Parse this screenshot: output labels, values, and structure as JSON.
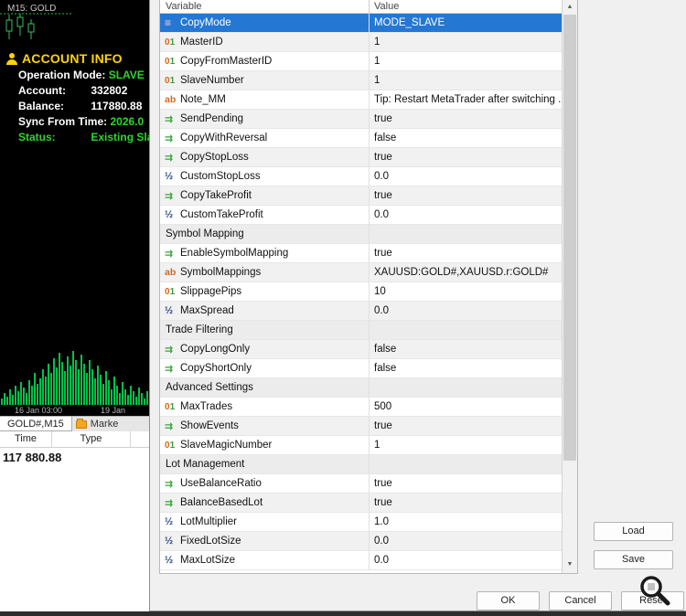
{
  "left_panel": {
    "chart_label": "M15: GOLD",
    "account_info": {
      "title": "ACCOUNT INFO",
      "rows": [
        {
          "label": "Operation Mode:",
          "value": "SLAVE"
        },
        {
          "label": "Account:",
          "value": "332802"
        },
        {
          "label": "Balance:",
          "value": "117880.88"
        },
        {
          "label": "Sync From Time:",
          "value": "2026.0"
        },
        {
          "label": "Status:",
          "value": "Existing Slave"
        }
      ]
    },
    "x_axis_labels": [
      "16 Jan 03:00",
      "19 Jan"
    ],
    "chart_tabs": [
      {
        "label": "GOLD#,M15"
      },
      {
        "label": "Marke"
      }
    ],
    "toolbox": {
      "columns": [
        "Time",
        "Type"
      ],
      "balance": "117 880.88"
    }
  },
  "dialog": {
    "table": {
      "headers": [
        "Variable",
        "Value"
      ],
      "rows": [
        {
          "type": "enum",
          "name": "CopyMode",
          "value": "MODE_SLAVE",
          "selected": true
        },
        {
          "type": "int",
          "name": "MasterID",
          "value": "1"
        },
        {
          "type": "int",
          "name": "CopyFromMasterID",
          "value": "1"
        },
        {
          "type": "int",
          "name": "SlaveNumber",
          "value": "1"
        },
        {
          "type": "str",
          "name": "Note_MM",
          "value": "Tip: Restart MetaTrader after switching ..."
        },
        {
          "type": "bool",
          "name": "SendPending",
          "value": "true"
        },
        {
          "type": "bool",
          "name": "CopyWithReversal",
          "value": "false"
        },
        {
          "type": "bool",
          "name": "CopyStopLoss",
          "value": "true"
        },
        {
          "type": "dbl",
          "name": "CustomStopLoss",
          "value": "0.0"
        },
        {
          "type": "bool",
          "name": "CopyTakeProfit",
          "value": "true"
        },
        {
          "type": "dbl",
          "name": "CustomTakeProfit",
          "value": "0.0"
        },
        {
          "type": "group",
          "name": "Symbol Mapping",
          "value": ""
        },
        {
          "type": "bool",
          "name": "EnableSymbolMapping",
          "value": "true"
        },
        {
          "type": "str",
          "name": "SymbolMappings",
          "value": "XAUUSD:GOLD#,XAUUSD.r:GOLD#"
        },
        {
          "type": "int",
          "name": "SlippagePips",
          "value": "10"
        },
        {
          "type": "dbl",
          "name": "MaxSpread",
          "value": "0.0"
        },
        {
          "type": "group",
          "name": "Trade Filtering",
          "value": ""
        },
        {
          "type": "bool",
          "name": "CopyLongOnly",
          "value": "false"
        },
        {
          "type": "bool",
          "name": "CopyShortOnly",
          "value": "false"
        },
        {
          "type": "group",
          "name": "Advanced Settings",
          "value": ""
        },
        {
          "type": "int",
          "name": "MaxTrades",
          "value": "500"
        },
        {
          "type": "bool",
          "name": "ShowEvents",
          "value": "true"
        },
        {
          "type": "int",
          "name": "SlaveMagicNumber",
          "value": "1"
        },
        {
          "type": "group",
          "name": "Lot Management",
          "value": ""
        },
        {
          "type": "bool",
          "name": "UseBalanceRatio",
          "value": "true"
        },
        {
          "type": "bool",
          "name": "BalanceBasedLot",
          "value": "true"
        },
        {
          "type": "dbl",
          "name": "LotMultiplier",
          "value": "1.0"
        },
        {
          "type": "dbl",
          "name": "FixedLotSize",
          "value": "0.0"
        },
        {
          "type": "dbl",
          "name": "MaxLotSize",
          "value": "0.0"
        }
      ]
    },
    "buttons": {
      "load": "Load",
      "save": "Save",
      "ok": "OK",
      "cancel": "Cancel",
      "reset": "Reset"
    }
  },
  "icons": {
    "enum": "≡",
    "int": "01",
    "str": "ab",
    "bool": "⇉",
    "dbl": "½",
    "group": "",
    "scroll_up": "▲",
    "scroll_down": "▼"
  },
  "colors": {
    "selection": "#2577d4",
    "accent_yellow": "#ffd400",
    "accent_green": "#2fd32f",
    "volume_green": "#00c24a"
  }
}
